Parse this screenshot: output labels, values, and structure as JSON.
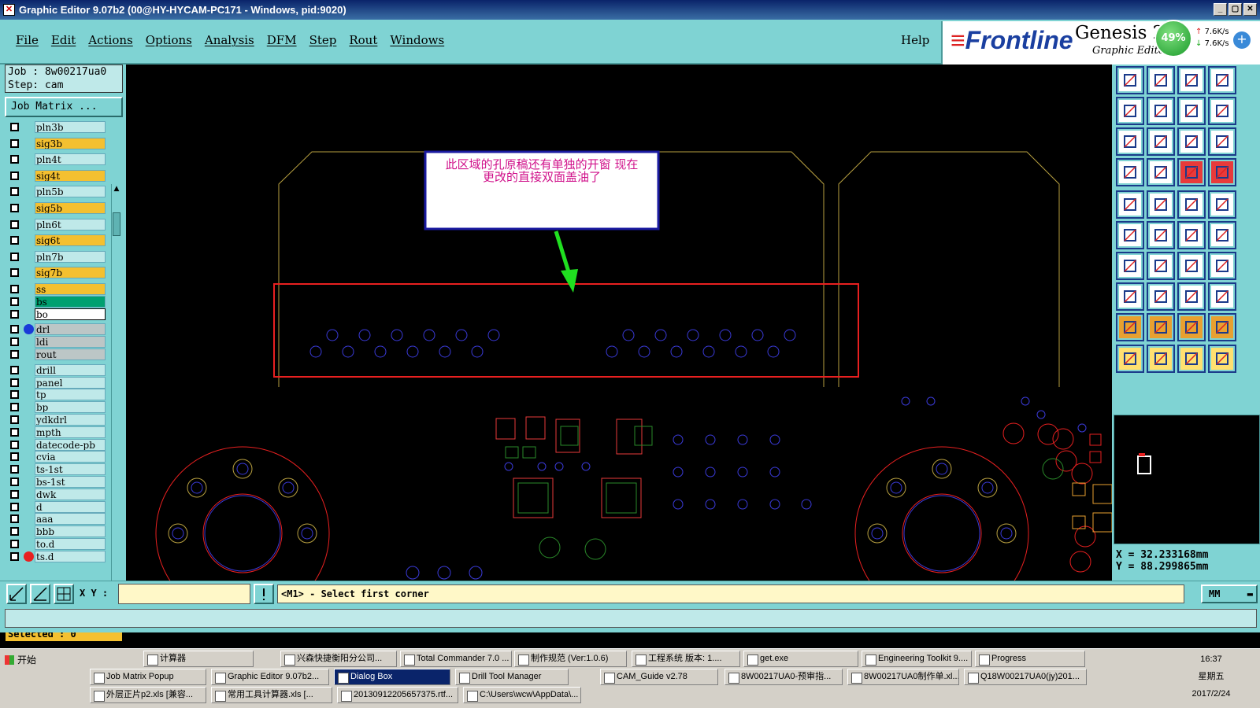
{
  "window": {
    "title": "Graphic Editor 9.07b2 (00@HY-HYCAM-PC171 - Windows, pid:9020)"
  },
  "menu": [
    "File",
    "Edit",
    "Actions",
    "Options",
    "Analysis",
    "DFM",
    "Step",
    "Rout",
    "Windows"
  ],
  "help_label": "Help",
  "brand": {
    "frontline": "Frontline",
    "genesis": "Genesis 20",
    "graphic_editor": "Graphic Editor"
  },
  "network": {
    "percent": "49%",
    "up": "7.6K/s",
    "down": "7.6K/s"
  },
  "job": {
    "job_line": "Job  : 8w00217ua0",
    "step_line": "Step: cam"
  },
  "job_matrix_label": "Job Matrix ...",
  "layers": [
    {
      "name": "pln3b",
      "kind": "pln"
    },
    {
      "name": "sig3b",
      "kind": "sig"
    },
    {
      "name": "pln4t",
      "kind": "pln"
    },
    {
      "name": "sig4t",
      "kind": "sig"
    },
    {
      "name": "pln5b",
      "kind": "pln"
    },
    {
      "name": "sig5b",
      "kind": "sig"
    },
    {
      "name": "pln6t",
      "kind": "pln"
    },
    {
      "name": "sig6t",
      "kind": "sig"
    },
    {
      "name": "pln7b",
      "kind": "pln"
    },
    {
      "name": "sig7b",
      "kind": "sig"
    },
    {
      "name": "ss",
      "kind": "sig"
    },
    {
      "name": "bs",
      "kind": "bs"
    },
    {
      "name": "bo",
      "kind": "boardc"
    },
    {
      "name": "drl",
      "kind": "grey"
    },
    {
      "name": "ldi",
      "kind": "grey"
    },
    {
      "name": "rout",
      "kind": "grey"
    },
    {
      "name": "drill",
      "kind": "pln"
    },
    {
      "name": "panel",
      "kind": "pln"
    },
    {
      "name": "tp",
      "kind": "pln"
    },
    {
      "name": "bp",
      "kind": "pln"
    },
    {
      "name": "ydkdrl",
      "kind": "pln"
    },
    {
      "name": "mpth",
      "kind": "pln"
    },
    {
      "name": "datecode-pb",
      "kind": "pln"
    },
    {
      "name": "cvia",
      "kind": "pln"
    },
    {
      "name": "ts-1st",
      "kind": "pln"
    },
    {
      "name": "bs-1st",
      "kind": "pln"
    },
    {
      "name": "dwk",
      "kind": "pln"
    },
    {
      "name": "d",
      "kind": "pln"
    },
    {
      "name": "aaa",
      "kind": "pln"
    },
    {
      "name": "bbb",
      "kind": "pln"
    },
    {
      "name": "to.d",
      "kind": "pln"
    },
    {
      "name": "ts.d",
      "kind": "pln"
    }
  ],
  "selected_label": "Selected : 0",
  "annotation": {
    "line1": "此区域的孔原稿还有单独的开窗   现在",
    "line2": "更改的直接双面盖油了"
  },
  "coords": {
    "x": "X  =  32.233168mm",
    "y": "Y  =  88.299865mm"
  },
  "cmd": {
    "xy_label": "X Y :",
    "prompt": "<M1> - Select first corner",
    "units": "MM"
  },
  "taskbar": {
    "start": "开始",
    "row1": [
      "计算器",
      "兴森快捷衡阳分公司...",
      "Total Commander 7.0 ...",
      "制作规范 (Ver:1.0.6)",
      "工程系统  版本: 1....",
      "get.exe",
      "Engineering Toolkit 9....",
      "Progress"
    ],
    "row2": [
      "Job Matrix Popup",
      "Graphic Editor 9.07b2...",
      "Dialog Box",
      "Drill Tool Manager",
      "CAM_Guide v2.78",
      "8W00217UA0-预审指...",
      "8W00217UA0制作单.xl...",
      "Q18W00217UA0(jy)201..."
    ],
    "row3": [
      "外层正片p2.xls [兼容...",
      "常用工具计算器.xls [...",
      "20130912205657375.rtf...",
      "C:\\Users\\wcw\\AppData\\..."
    ],
    "time": "16:37",
    "day": "星期五",
    "date": "2017/2/24"
  },
  "colors": {
    "panel": "#7fd3d3",
    "board_outline": "#b8a040",
    "select_rect": "#e82020",
    "pad_blue": "#3a3ad8",
    "arrow": "#20e020"
  }
}
